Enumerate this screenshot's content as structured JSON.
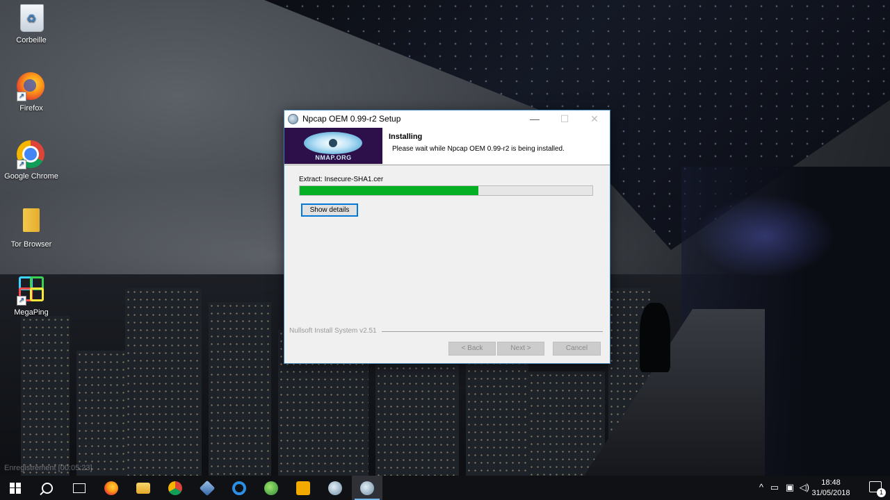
{
  "desktop": {
    "icons": [
      {
        "label": "Corbeille",
        "icon": "recycle-bin-icon"
      },
      {
        "label": "Firefox",
        "icon": "firefox-icon"
      },
      {
        "label": "Google Chrome",
        "icon": "chrome-icon"
      },
      {
        "label": "Tor Browser",
        "icon": "folder-icon"
      },
      {
        "label": "MegaPing",
        "icon": "megaping-icon"
      }
    ],
    "watermark": "Enregistrement [00:05:23]"
  },
  "installer": {
    "title": "Npcap OEM 0.99-r2 Setup",
    "minimize_glyph": "—",
    "maximize_glyph": "☐",
    "close_glyph": "✕",
    "banner_text": "NMAP.ORG",
    "header_title": "Installing",
    "header_subtitle": "Please wait while Npcap OEM 0.99-r2 is being installed.",
    "extract_label": "Extract: Insecure-SHA1.cer",
    "progress_fraction": 0.61,
    "progress_color": "#06b025",
    "show_details_label": "Show details",
    "nsis_label": "Nullsoft Install System v2.51",
    "back_label": "< Back",
    "next_label": "Next >",
    "cancel_label": "Cancel"
  },
  "taskbar": {
    "apps": [
      "start-icon",
      "search-icon",
      "task-view-icon",
      "firefox-icon",
      "file-explorer-icon",
      "chrome-icon",
      "virtualbox-icon",
      "edge-icon",
      "network-globe-icon",
      "media-player-icon",
      "npcap-setup-icon",
      "npcap-setup-icon"
    ],
    "tray_chevron": "^",
    "clock_time": "18:48",
    "clock_date": "31/05/2018",
    "notification_count": "1"
  }
}
